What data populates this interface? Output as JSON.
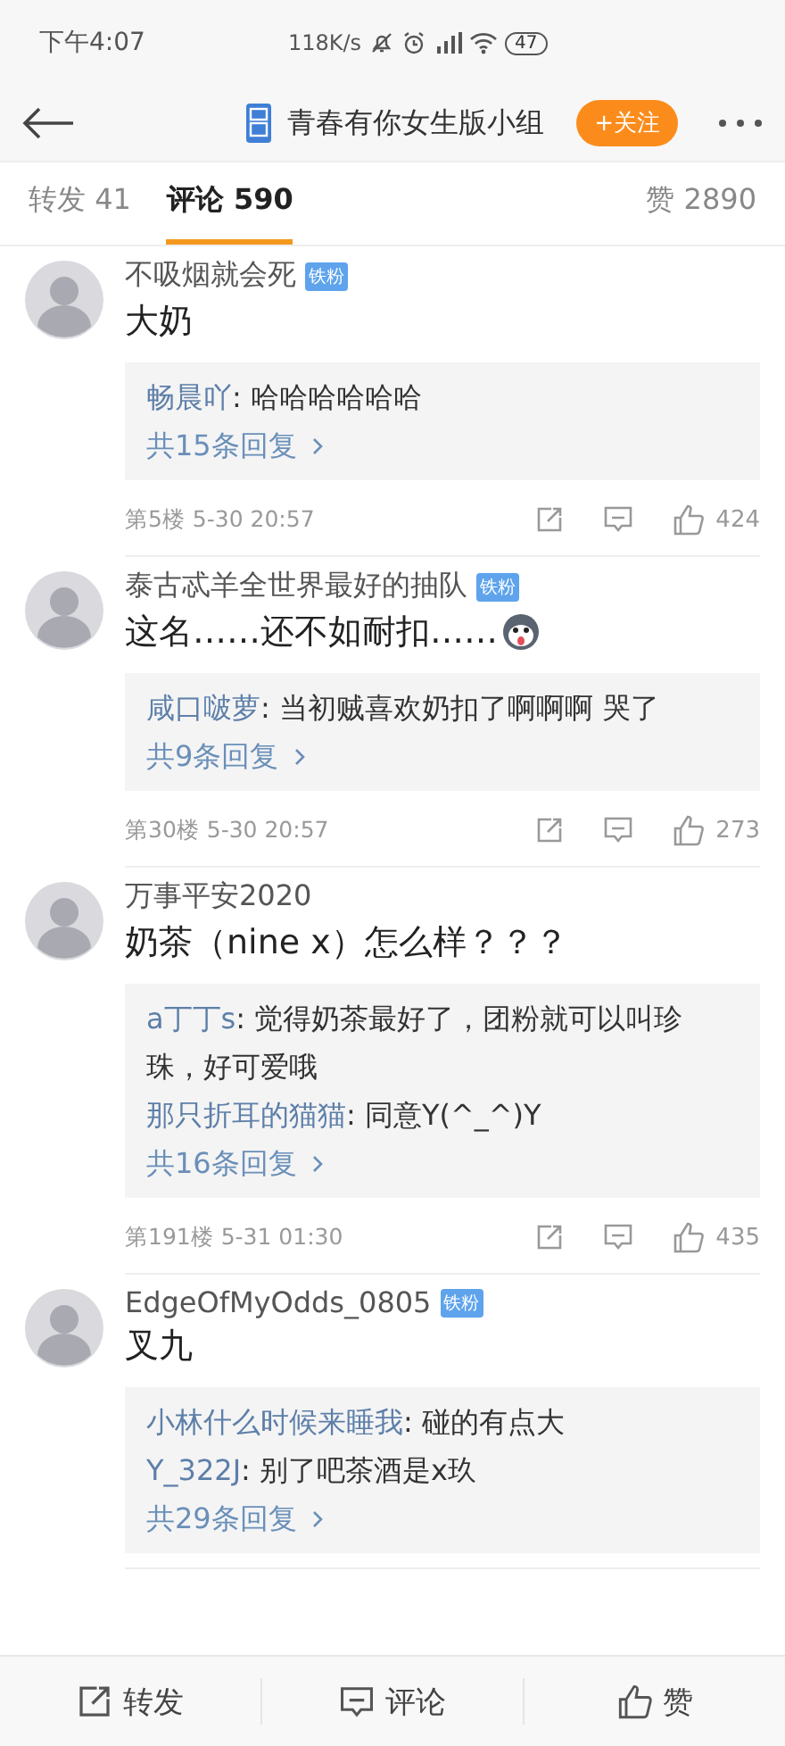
{
  "status_bar": {
    "time": "下午4:07",
    "speed": "118K/s",
    "battery": "47"
  },
  "header": {
    "title": "青春有你女生版小组",
    "follow_button": "+关注"
  },
  "tabs": [
    {
      "label": "转发 41",
      "selected": false
    },
    {
      "label": "评论 590",
      "selected": true
    }
  ],
  "likes_tab": "赞 2890",
  "comments": [
    {
      "user": "不吸烟就会死",
      "fan_badge": "铁粉",
      "text": "大奶",
      "emoji": false,
      "replies": [
        {
          "user": "畅晨吖",
          "text": ": 哈哈哈哈哈哈"
        }
      ],
      "more_replies": "共15条回复",
      "floor": "第5楼 5-30 20:57",
      "likes": "424"
    },
    {
      "user": "泰古忒羊全世界最好的抽队",
      "fan_badge": "铁粉",
      "text": "这名……还不如耐扣……",
      "emoji": true,
      "replies": [
        {
          "user": "咸口啵萝",
          "text": ": 当初贼喜欢奶扣了啊啊啊 哭了"
        }
      ],
      "more_replies": "共9条回复",
      "floor": "第30楼 5-30 20:57",
      "likes": "273"
    },
    {
      "user": "万事平安2020",
      "text": "奶茶（nine x）怎么样？？？",
      "emoji": false,
      "replies": [
        {
          "user": "a丁丁s",
          "text": ": 觉得奶茶最好了，团粉就可以叫珍珠，好可爱哦"
        },
        {
          "user": "那只折耳的猫猫",
          "text": ": 同意Y(^_^)Y"
        }
      ],
      "more_replies": "共16条回复",
      "floor": "第191楼 5-31 01:30",
      "likes": "435"
    },
    {
      "user": "EdgeOfMyOdds_0805",
      "fan_badge": "铁粉",
      "text": "叉九",
      "emoji": false,
      "replies": [
        {
          "user": "小林什么时候来睡我",
          "text": ": 碰的有点大"
        },
        {
          "user": "Y_322J",
          "text": ": 别了吧茶酒是x玖"
        }
      ],
      "more_replies": "共29条回复"
    }
  ],
  "bottom_bar": [
    {
      "kind": "repost",
      "label": "转发"
    },
    {
      "kind": "comment",
      "label": "评论"
    },
    {
      "kind": "like",
      "label": "赞"
    }
  ]
}
